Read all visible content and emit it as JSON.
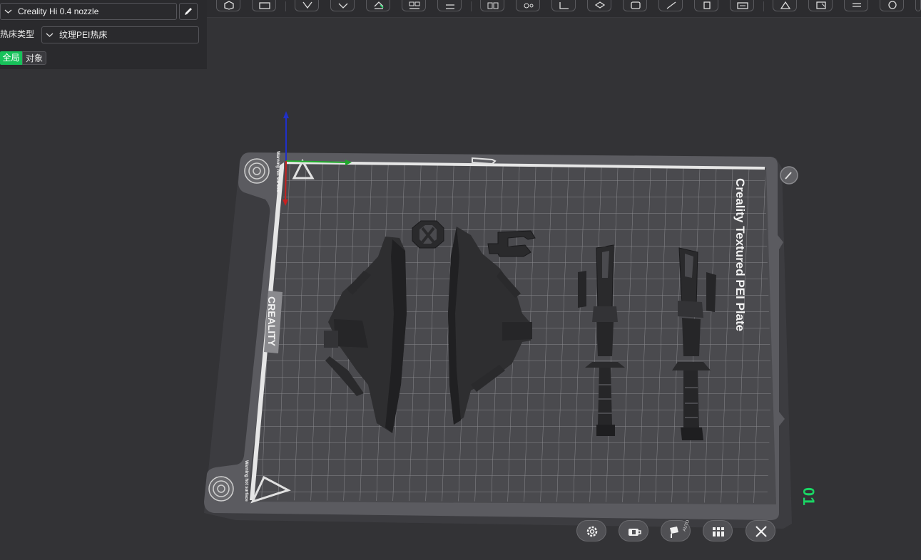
{
  "printer": {
    "name": "Creality Hi 0.4 nozzle",
    "edit_icon": "pencil-icon"
  },
  "bed": {
    "label": "热床类型",
    "value": "纹理PEI热床"
  },
  "scope_toggle": {
    "global_label": "全局",
    "object_label": "对象",
    "active": "global",
    "active_color": "#17c25a"
  },
  "toolbar": {
    "icons": [
      "add-object-icon",
      "plate-grid-icon",
      "orient-icon",
      "arrange-icon",
      "auto-orient-icon",
      "layout-icon",
      "lay-flat-icon",
      "split-icon",
      "settings-icon",
      "cut-icon",
      "plane-icon",
      "support-paint-icon",
      "seam-paint-icon",
      "measure-icon",
      "box-icon",
      "ruler-icon",
      "assembly-icon",
      "text-icon",
      "shell-icon",
      "view-icon"
    ]
  },
  "plate": {
    "title": "Creality Textured PEI Plate",
    "brand": "CREALITY",
    "warning_top": "Warning hot surface",
    "warning_bottom": "Warning hot surface",
    "number": "01",
    "number_color": "#1ad664"
  },
  "plate_controls": [
    {
      "name": "plate-settings-button",
      "icon": "gear-icon"
    },
    {
      "name": "plate-lock-button",
      "icon": "lock-icon"
    },
    {
      "name": "plate-auto-arrange-button",
      "icon": "auto-arrange-icon",
      "tag": "AUTO"
    },
    {
      "name": "plate-orient-button",
      "icon": "orient-all-icon"
    },
    {
      "name": "plate-delete-button",
      "icon": "close-icon"
    }
  ]
}
